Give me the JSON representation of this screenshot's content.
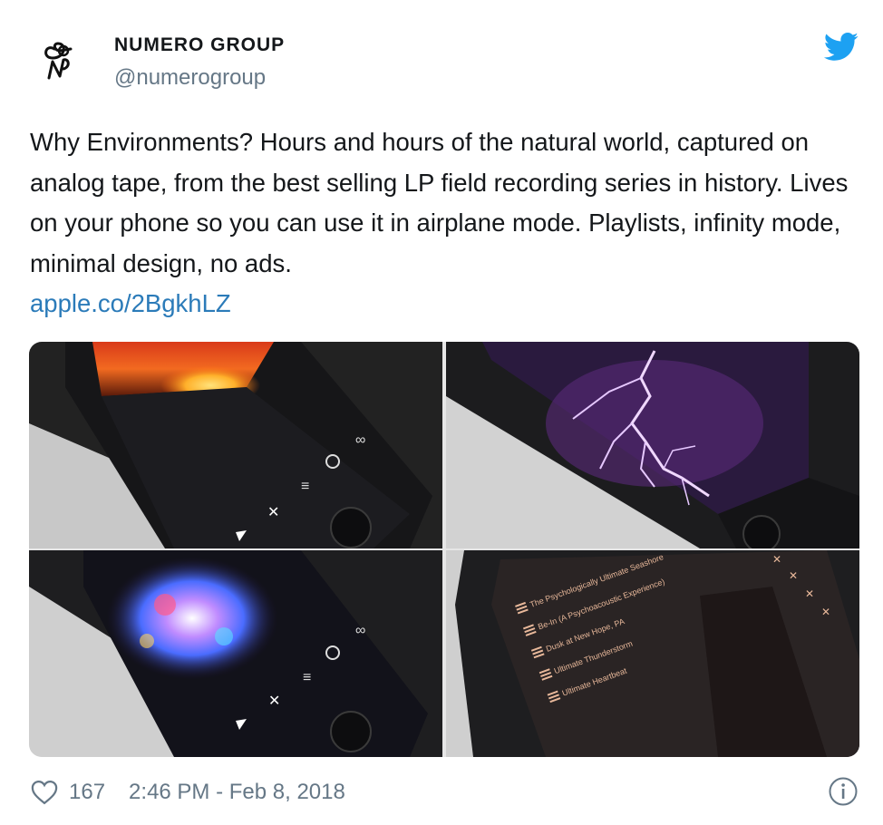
{
  "account": {
    "name": "NUMERO GROUP",
    "handle": "@numerogroup",
    "avatar_icon": "numero-logo-icon",
    "platform_icon": "twitter-bird-icon",
    "brand_color": "#1da1f2"
  },
  "tweet": {
    "text": "Why Environments? Hours and hours of the natural world, captured on analog tape, from the best selling LP field recording series in history. Lives on your phone so you can use it in airplane mode. Playlists, infinity mode, minimal design, no ads.",
    "link": "apple.co/2BgkhLZ",
    "link_color": "#2b7bb9"
  },
  "media": {
    "photos": [
      {
        "subject": "phone-sunset-screen",
        "controls": [
          "∞",
          "i",
          "≡",
          "✕",
          "▶"
        ]
      },
      {
        "subject": "phone-lightning-screen"
      },
      {
        "subject": "phone-nebula-screen",
        "controls": [
          "∞",
          "i",
          "≡",
          "✕",
          "▶"
        ]
      },
      {
        "subject": "phone-playlist-screen",
        "playlist": [
          "The Psychologically Ultimate Seashore",
          "Be-In (A Psychoacoustic Experience)",
          "Dusk at New Hope, PA",
          "Ultimate Thunderstorm",
          "Ultimate Heartbeat"
        ]
      }
    ]
  },
  "footer": {
    "likes": "167",
    "timestamp": "2:46 PM - Feb 8, 2018",
    "heart_icon": "heart-icon",
    "info_icon": "info-icon"
  }
}
